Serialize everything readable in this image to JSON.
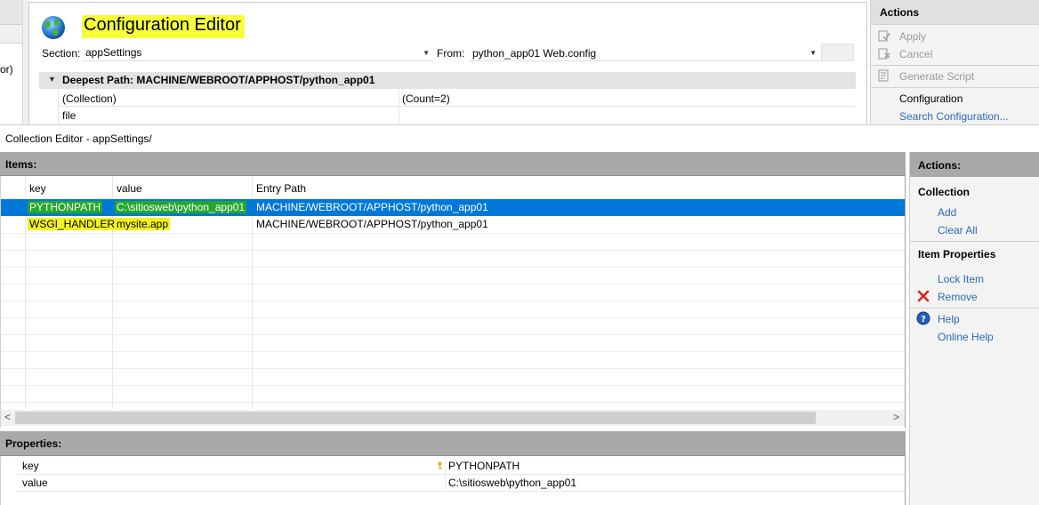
{
  "background": {
    "left_fragment": "or)",
    "title": "Configuration Editor",
    "section_label": "Section:",
    "section_value": "appSettings",
    "from_label": "From:",
    "from_value": "python_app01 Web.config",
    "deepest_path": "Deepest Path: MACHINE/WEBROOT/APPHOST/python_app01",
    "grid_rows": [
      {
        "name": "(Collection)",
        "value": "(Count=2)"
      },
      {
        "name": "file",
        "value": ""
      }
    ],
    "actions": {
      "header": "Actions",
      "apply": "Apply",
      "cancel": "Cancel",
      "generate_script": "Generate Script",
      "configuration_heading": "Configuration",
      "search_configuration": "Search Configuration..."
    }
  },
  "dialog": {
    "title": "Collection Editor - appSettings/",
    "items_header": "Items:",
    "columns": [
      "key",
      "value",
      "Entry Path"
    ],
    "rows": [
      {
        "key": "PYTHONPATH",
        "value": "C:\\sitiosweb\\python_app01",
        "path": "MACHINE/WEBROOT/APPHOST/python_app01",
        "selected": true
      },
      {
        "key": "WSGI_HANDLER",
        "value": "mysite.app",
        "path": "MACHINE/WEBROOT/APPHOST/python_app01",
        "selected": false
      }
    ],
    "properties_header": "Properties:",
    "properties": [
      {
        "name": "key",
        "value": "PYTHONPATH",
        "is_key": true
      },
      {
        "name": "value",
        "value": "C:\\sitiosweb\\python_app01",
        "is_key": false
      }
    ],
    "actions": {
      "header": "Actions:",
      "collection_heading": "Collection",
      "add": "Add",
      "clear_all": "Clear All",
      "item_properties_heading": "Item Properties",
      "lock_item": "Lock Item",
      "remove": "Remove",
      "help": "Help",
      "online_help": "Online Help"
    }
  },
  "colors": {
    "selection": "#0078d7",
    "highlight_yellow": "#f2f220",
    "highlight_green": "#25a72c",
    "section_header": "#a9a9a9",
    "link": "#2d6ab4",
    "remove_red": "#d9241b"
  }
}
